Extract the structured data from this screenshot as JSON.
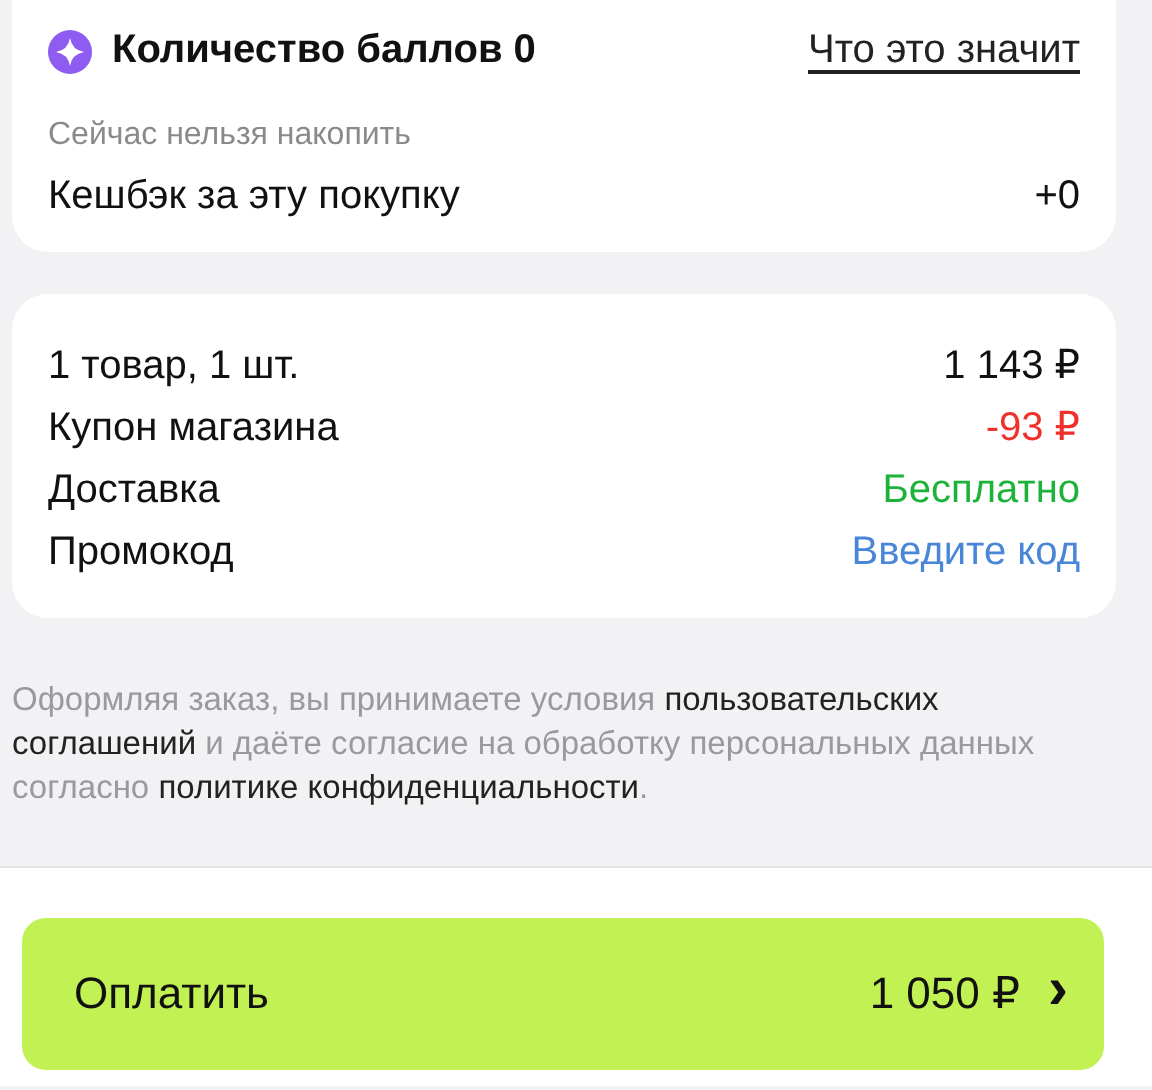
{
  "points_card": {
    "title": "Количество баллов 0",
    "help_link": "Что это значит",
    "note": "Сейчас нельзя накопить",
    "cashback_label": "Кешбэк за эту покупку",
    "cashback_value": "+0"
  },
  "summary": {
    "rows": [
      {
        "label": "1 товар, 1 шт.",
        "value": "1 143 ₽",
        "kind": "price"
      },
      {
        "label": "Купон магазина",
        "value": "-93 ₽",
        "kind": "discount"
      },
      {
        "label": "Доставка",
        "value": "Бесплатно",
        "kind": "free"
      },
      {
        "label": "Промокод",
        "value": "Введите код",
        "kind": "link"
      }
    ]
  },
  "legal_text": "Оформляя заказ, вы принимаете условия **пользовательских соглашений** и даёте согласие на обработку персональных данных согласно **политике конфиденциальности**.",
  "pay_button": {
    "label": "Оплатить",
    "amount": "1 050 ₽",
    "arrow": "›"
  }
}
